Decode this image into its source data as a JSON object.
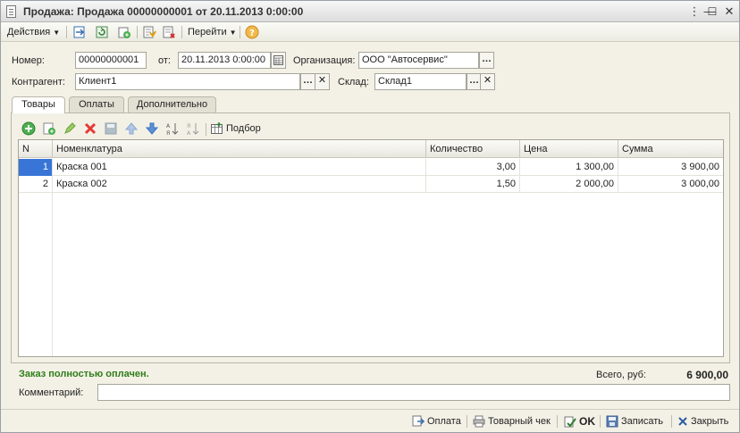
{
  "window": {
    "title": "Продажа: Продажа 00000000001 от 20.11.2013 0:00:00"
  },
  "toolbar": {
    "actions_label": "Действия",
    "goto_label": "Перейти"
  },
  "form": {
    "number_label": "Номер:",
    "number_value": "00000000001",
    "date_label": "от:",
    "date_value": "20.11.2013  0:00:00",
    "org_label": "Организация:",
    "org_value": "ООО \"Автосервис\"",
    "counterparty_label": "Контрагент:",
    "counterparty_value": "Клиент1",
    "warehouse_label": "Склад:",
    "warehouse_value": "Склад1"
  },
  "tabs": [
    {
      "label": "Товары",
      "active": true
    },
    {
      "label": "Оплаты",
      "active": false
    },
    {
      "label": "Дополнительно",
      "active": false
    }
  ],
  "grid_toolbar": {
    "selection_label": "Подбор"
  },
  "table": {
    "columns": [
      "N",
      "Номенклатура",
      "Количество",
      "Цена",
      "Сумма"
    ],
    "rows": [
      {
        "n": "1",
        "item": "Краска 001",
        "qty": "3,00",
        "price": "1 300,00",
        "sum": "3 900,00"
      },
      {
        "n": "2",
        "item": "Краска 002",
        "qty": "1,50",
        "price": "2 000,00",
        "sum": "3 000,00"
      }
    ]
  },
  "status": {
    "message": "Заказ полностью оплачен.",
    "color": "#2e7d1a"
  },
  "totals": {
    "label": "Всего, руб:",
    "value": "6 900,00"
  },
  "comment": {
    "label": "Комментарий:",
    "value": ""
  },
  "bottom": {
    "payment_label": "Оплата",
    "receipt_label": "Товарный чек",
    "ok_label": "OK",
    "save_label": "Записать",
    "close_label": "Закрыть"
  }
}
